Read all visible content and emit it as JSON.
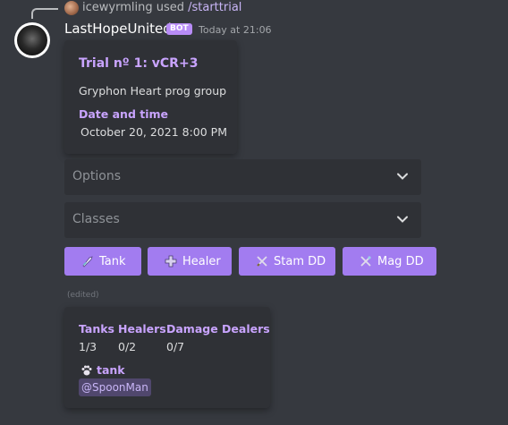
{
  "reply": {
    "username": "icewyrmling",
    "used_word": "used",
    "command": "/starttrial"
  },
  "message": {
    "author": "LastHopeUnited",
    "badge": "BOT",
    "timestamp": "Today at 21:06",
    "edited_label": "(edited)"
  },
  "embed": {
    "title": "Trial nº 1: vCR+3",
    "description": "Gryphon Heart prog group",
    "field_name": "Date and time",
    "field_value": "October 20, 2021 8:00 PM"
  },
  "selects": [
    {
      "label": "Options"
    },
    {
      "label": "Classes"
    }
  ],
  "buttons": [
    {
      "label": "Tank",
      "icon": "tank-shield-icon"
    },
    {
      "label": "Healer",
      "icon": "healer-cross-icon"
    },
    {
      "label": "Stam DD",
      "icon": "stam-swords-icon"
    },
    {
      "label": "Mag DD",
      "icon": "mag-staff-icon"
    }
  ],
  "roster": {
    "columns": [
      {
        "header": "Tanks",
        "value": "1/3"
      },
      {
        "header": "Healers",
        "value": "0/2"
      },
      {
        "header": "Damage Dealers",
        "value": "0/7"
      }
    ],
    "role_label": "tank",
    "role_icon": "paw-icon",
    "member": "@SpoonMan"
  },
  "colors": {
    "background": "#36393f",
    "embed_bg": "#2f3136",
    "accent": "#a27cf0",
    "title_purple": "#c9a4ff"
  }
}
